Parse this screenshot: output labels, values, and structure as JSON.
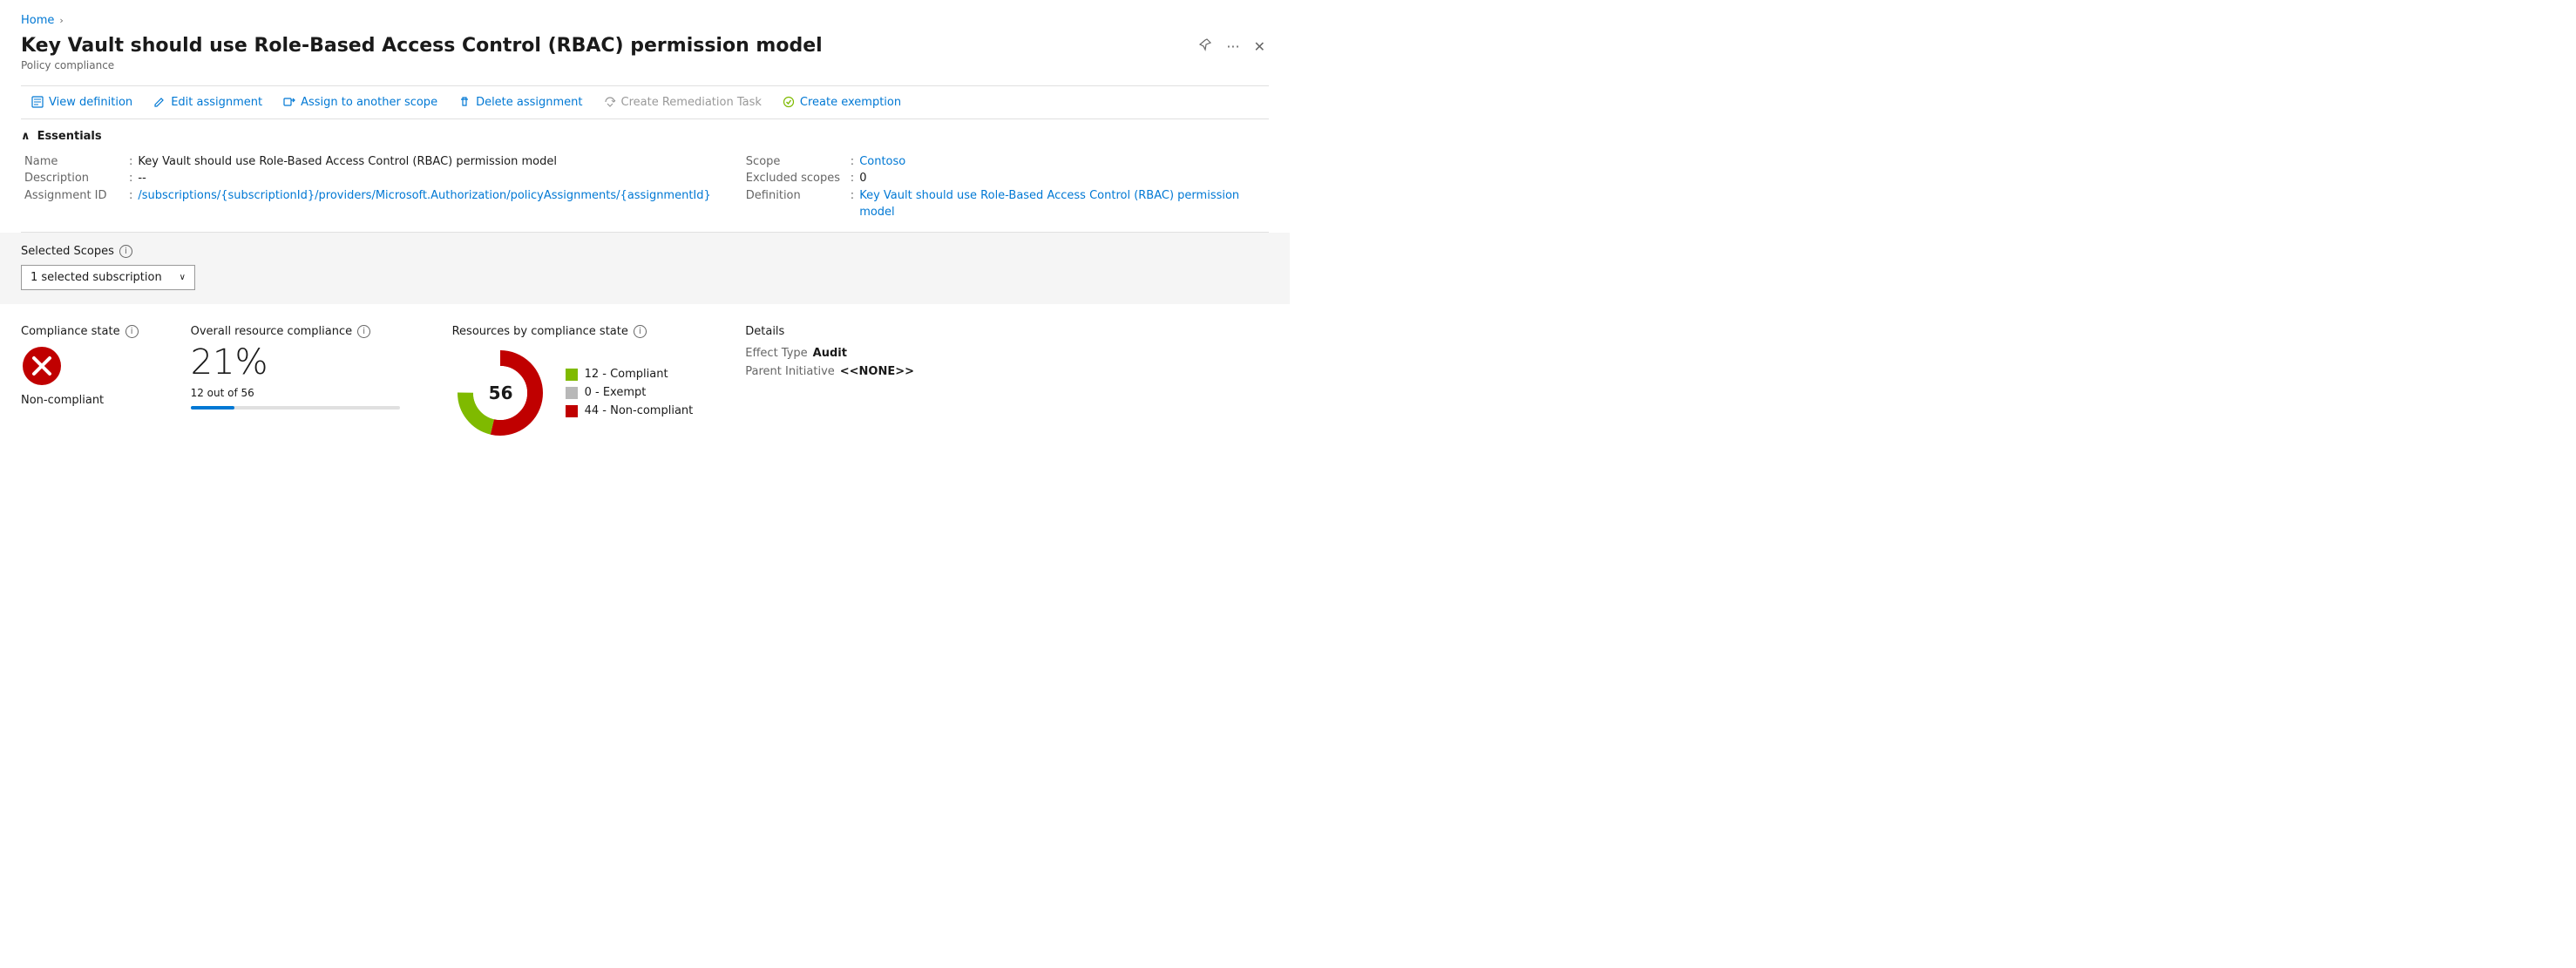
{
  "breadcrumb": {
    "home": "Home",
    "sep": "›"
  },
  "page": {
    "title": "Key Vault should use Role-Based Access Control (RBAC) permission model",
    "subtitle": "Policy compliance"
  },
  "toolbar": {
    "view_definition": "View definition",
    "edit_assignment": "Edit assignment",
    "assign_to_scope": "Assign to another scope",
    "delete_assignment": "Delete assignment",
    "create_remediation": "Create Remediation Task",
    "create_exemption": "Create exemption"
  },
  "essentials": {
    "section_title": "Essentials",
    "name_label": "Name",
    "name_value": "Key Vault should use Role-Based Access Control (RBAC) permission model",
    "description_label": "Description",
    "description_value": "--",
    "assignment_id_label": "Assignment ID",
    "assignment_id_value": "/subscriptions/{subscriptionId}/providers/Microsoft.Authorization/policyAssignments/{assignmentId}",
    "scope_label": "Scope",
    "scope_value": "Contoso",
    "excluded_scopes_label": "Excluded scopes",
    "excluded_scopes_value": "0",
    "definition_label": "Definition",
    "definition_value": "Key Vault should use Role-Based Access Control (RBAC) permission model"
  },
  "scopes": {
    "label": "Selected Scopes",
    "dropdown_value": "1 selected subscription"
  },
  "compliance_state": {
    "title": "Compliance state",
    "state": "Non-compliant",
    "icon_type": "error"
  },
  "overall_compliance": {
    "title": "Overall resource compliance",
    "percent": "21%",
    "detail": "12 out of 56",
    "fill_percent": 21
  },
  "resources_by_state": {
    "title": "Resources by compliance state",
    "total": "56",
    "compliant_count": 12,
    "exempt_count": 0,
    "noncompliant_count": 44,
    "compliant_label": "12 - Compliant",
    "exempt_label": "0 - Exempt",
    "noncompliant_label": "44 - Non-compliant",
    "colors": {
      "compliant": "#7fba00",
      "exempt": "#b8b8b8",
      "noncompliant": "#c00000"
    }
  },
  "details": {
    "title": "Details",
    "effect_type_label": "Effect Type",
    "effect_type_value": "Audit",
    "parent_initiative_label": "Parent Initiative",
    "parent_initiative_value": "<<NONE>>"
  },
  "icons": {
    "pin": "📌",
    "more": "···",
    "close": "✕",
    "chevron_right": "›",
    "chevron_down": "∨",
    "collapse": "∧"
  }
}
